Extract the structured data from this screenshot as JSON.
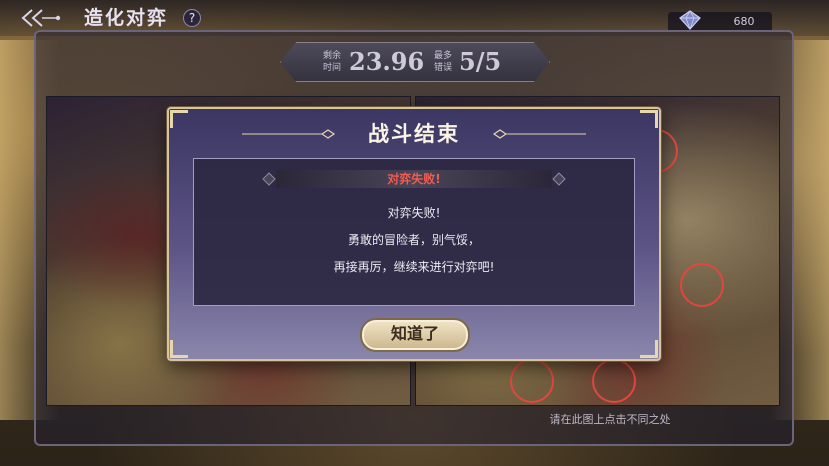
{
  "header": {
    "title": "造化对弈",
    "help_label": "?",
    "back_icon": "double-chevron-back-icon",
    "currency": {
      "icon": "crystal-icon",
      "value": "680"
    }
  },
  "hud": {
    "time_label": "剩余时间",
    "time_value": "23.96",
    "limit_label": "最多错误",
    "count_value": "5/5"
  },
  "game": {
    "hint": "请在此图上点击不同之处",
    "marker_color": "#e2473f"
  },
  "modal": {
    "title": "战斗结束",
    "result_label": "对弈失败!",
    "messages": [
      "对弈失败!",
      "勇敢的冒险者，别气馁，",
      "再接再厉，继续来进行对弈吧!"
    ],
    "ok_button": "知道了",
    "colors": {
      "fail": "#ef5d4e",
      "border": "#d9c49a"
    }
  }
}
